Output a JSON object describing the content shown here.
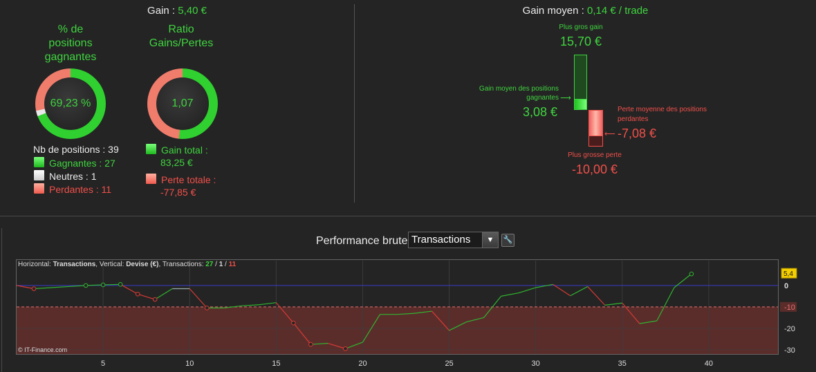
{
  "summary": {
    "gain_label": "Gain :",
    "gain_value": "5,40 €",
    "pct_title": "% de positions gagnantes",
    "pct_value": "69,23 %",
    "pct_fraction": 0.6923,
    "neutral_fraction": 0.0256,
    "ratio_title": "Ratio Gains/Pertes",
    "ratio_value": "1,07",
    "ratio_win_share": 0.5167,
    "nb_positions": "Nb de positions : 39",
    "winners": "Gagnantes : 27",
    "neutral": "Neutres : 1",
    "losers": "Perdantes : 11",
    "gain_total_label": "Gain total :",
    "gain_total_value": "83,25 €",
    "loss_total_label": "Perte totale :",
    "loss_total_value": "-77,85 €"
  },
  "average": {
    "title_label": "Gain moyen :",
    "title_value": "0,14 € / trade",
    "biggest_gain_label": "Plus gros gain",
    "biggest_gain_value": "15,70 €",
    "avg_win_label": "Gain moyen des positions gagnantes",
    "avg_win_value": "3,08 €",
    "avg_loss_label": "Perte moyenne des positions perdantes",
    "avg_loss_value": "-7,08 €",
    "biggest_loss_label": "Plus grosse perte",
    "biggest_loss_value": "-10,00 €"
  },
  "performance": {
    "label": "Performance brute",
    "selected": "Transactions",
    "dropdown_arrow": "▼",
    "wrench_icon": "🔧"
  },
  "chart_header": {
    "h_prefix": "Horizontal: ",
    "h_value": "Transactions",
    "v_prefix": ", Vertical: ",
    "v_value": "Devise (€)",
    "t_prefix": ", Transactions: ",
    "t_win": "27",
    "t_sep1": " / ",
    "t_neutral": "1",
    "t_sep2": " / ",
    "t_loss": "11"
  },
  "copyright": "© IT-Finance.com",
  "colors": {
    "green": "#3fd43f",
    "red": "#f0504a",
    "zero_line": "#3a3acc"
  },
  "chart_data": {
    "type": "line",
    "x": [
      0,
      1,
      2,
      3,
      4,
      5,
      6,
      7,
      8,
      9,
      10,
      11,
      12,
      13,
      14,
      15,
      16,
      17,
      18,
      19,
      20,
      21,
      22,
      23,
      24,
      25,
      26,
      27,
      28,
      29,
      30,
      31,
      32,
      33,
      34,
      35,
      36,
      37,
      38,
      39
    ],
    "y": [
      0,
      -1.5,
      -1,
      -0.5,
      0,
      0.3,
      0.5,
      0.8,
      -4,
      -6.5,
      -1.5,
      -1.5,
      -10.5,
      -10.5,
      -9.5,
      -9,
      -8,
      -17.5,
      -27.5,
      -27,
      -29.5,
      -26.5,
      -13.5,
      -13.5,
      -13,
      -12,
      -21,
      -17,
      -15,
      -5,
      -3.5,
      -1,
      0.5,
      -4.8,
      -0.5,
      -9.2,
      -8.2,
      -17.8,
      -16.5,
      -1,
      5.4
    ],
    "y_points": [
      0,
      -1.5,
      -1,
      -0.5,
      0,
      0.3,
      0.5,
      -4,
      -6.5,
      -1.5,
      -1.5,
      -10.5,
      -10.5,
      -9.5,
      -9,
      -8,
      -17.5,
      -27.5,
      -27,
      -29.5,
      -26.5,
      -13.5,
      -13.5,
      -13,
      -12,
      -21,
      -17,
      -15,
      -5,
      -3.5,
      -1,
      0.5,
      -4.8,
      -0.5,
      -9.2,
      -8.2,
      -17.8,
      -16.5,
      -1,
      5.4
    ],
    "trade_results": [
      "loss",
      "win",
      "win",
      "win",
      "win",
      "win",
      "loss",
      "loss",
      "win",
      "neutral",
      "loss",
      "win",
      "win",
      "win",
      "win",
      "loss",
      "loss",
      "win",
      "loss",
      "win",
      "win",
      "win",
      "win",
      "win",
      "loss",
      "win",
      "win",
      "win",
      "win",
      "win",
      "win",
      "loss",
      "win",
      "loss",
      "win",
      "loss",
      "win",
      "win",
      "win"
    ],
    "markers": [
      1,
      4,
      5,
      6,
      7,
      8,
      11,
      16,
      17,
      19,
      39
    ],
    "x_ticks": [
      "5",
      "10",
      "15",
      "20",
      "25",
      "30",
      "35",
      "40"
    ],
    "y_ticks": [
      "0",
      "-10",
      "-20",
      "-30"
    ],
    "xlim": [
      0,
      44
    ],
    "ylim": [
      -32,
      9
    ],
    "threshold": -10,
    "threshold_label": "-10",
    "last_value_label": "5,4",
    "xlabel": "Transactions",
    "ylabel": "Devise (€)"
  }
}
